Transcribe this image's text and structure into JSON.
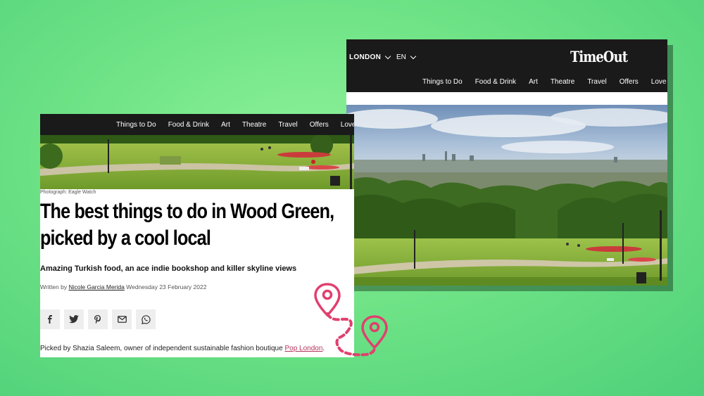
{
  "right_card": {
    "location": "LONDON",
    "language": "EN",
    "logo_text": "TimeOut",
    "nav": [
      "Things to Do",
      "Food & Drink",
      "Art",
      "Theatre",
      "Travel",
      "Offers",
      "Love"
    ]
  },
  "left_card": {
    "nav": [
      "Things to Do",
      "Food & Drink",
      "Art",
      "Theatre",
      "Travel",
      "Offers",
      "Love"
    ],
    "photo_credit": "Photograph: Eagle Watch",
    "headline_line1": "The best things to do in Wood Green,",
    "headline_line2": "picked by a cool local",
    "subheadline": "Amazing Turkish food, an ace indie bookshop and killer skyline views",
    "byline": {
      "prefix": "Written by",
      "author": "Nicole Garcia Merida",
      "date": "Wednesday 23 February 2022"
    },
    "share_icons": [
      "facebook-icon",
      "twitter-icon",
      "pinterest-icon",
      "email-icon",
      "whatsapp-icon"
    ],
    "body": {
      "text": "Picked by Shazia Saleem, owner of independent sustainable fashion boutique",
      "link": "Pop London",
      "suffix": "."
    }
  },
  "colors": {
    "background": "#6fe386",
    "nav_bar": "#1a1a1a",
    "pin": "#e0406e",
    "link": "#b3365a"
  }
}
